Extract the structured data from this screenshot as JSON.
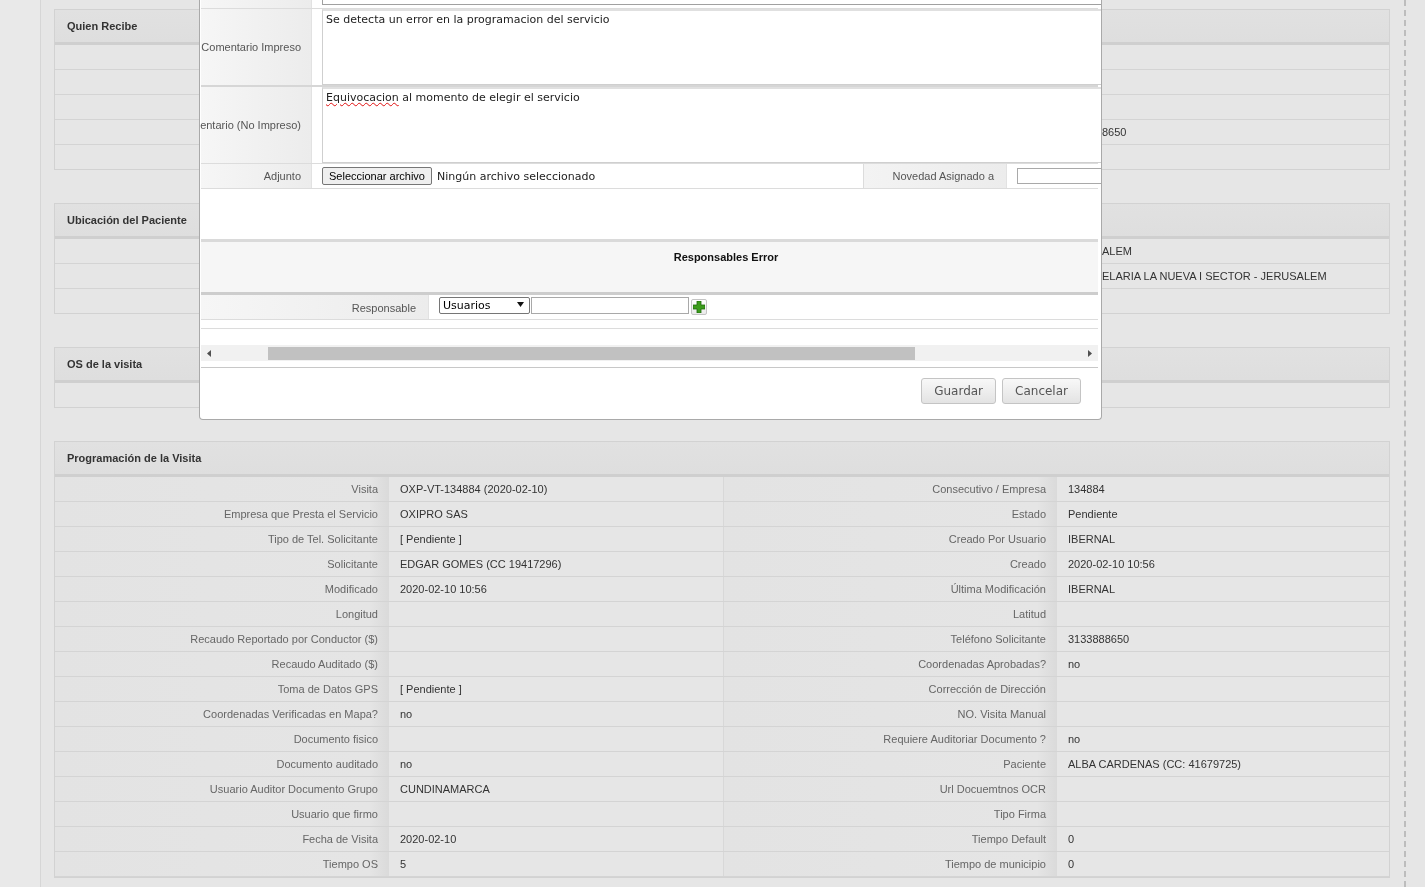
{
  "side_panels": [
    {
      "title": "Quien Recibe",
      "rows": [
        {},
        {},
        {},
        {
          "value": "8650"
        },
        {}
      ]
    },
    {
      "title": "Ubicación del Paciente",
      "rows": [
        {
          "value": "ALEM"
        },
        {
          "value": "ELARIA LA NUEVA I SECTOR - JERUSALEM"
        },
        {}
      ]
    },
    {
      "title": "OS de la visita",
      "rows": [
        {}
      ]
    }
  ],
  "visit_schedule": {
    "title": "Programación de la Visita",
    "rows": [
      {
        "left": {
          "label": "Visita",
          "value": "OXP-VT-134884 (2020-02-10)"
        },
        "right": {
          "label": "Consecutivo / Empresa",
          "value": "134884"
        }
      },
      {
        "left": {
          "label": "Empresa que Presta el Servicio",
          "value": "OXIPRO SAS"
        },
        "right": {
          "label": "Estado",
          "value": "Pendiente"
        }
      },
      {
        "left": {
          "label": "Tipo de Tel. Solicitante",
          "value": "[ Pendiente ]"
        },
        "right": {
          "label": "Creado Por Usuario",
          "value": "IBERNAL"
        }
      },
      {
        "left": {
          "label": "Solicitante",
          "value": "EDGAR GOMES (CC 19417296)"
        },
        "right": {
          "label": "Creado",
          "value": "2020-02-10 10:56"
        }
      },
      {
        "left": {
          "label": "Modificado",
          "value": "2020-02-10 10:56"
        },
        "right": {
          "label": "Última Modificación",
          "value": "IBERNAL"
        }
      },
      {
        "left": {
          "label": "Longitud"
        },
        "right": {
          "label": "Latitud"
        }
      },
      {
        "left": {
          "label": "Recaudo Reportado por Conductor ($)"
        },
        "right": {
          "label": "Teléfono Solicitante",
          "value": "3133888650"
        }
      },
      {
        "left": {
          "label": "Recaudo Auditado ($)"
        },
        "right": {
          "label": "Coordenadas Aprobadas?",
          "value": "no"
        }
      },
      {
        "left": {
          "label": "Toma de Datos GPS",
          "value": "[ Pendiente ]"
        },
        "right": {
          "label": "Corrección de Dirección"
        }
      },
      {
        "left": {
          "label": "Coordenadas Verificadas en Mapa?",
          "value": "no"
        },
        "right": {
          "label": "NO. Visita Manual"
        }
      },
      {
        "left": {
          "label": "Documento fisico"
        },
        "right": {
          "label": "Requiere Auditoriar Documento ?",
          "value": "no"
        }
      },
      {
        "left": {
          "label": "Documento auditado",
          "value": "no"
        },
        "right": {
          "label": "Paciente",
          "value": "ALBA CARDENAS (CC: 41679725)"
        }
      },
      {
        "left": {
          "label": "Usuario Auditor Documento Grupo",
          "value": "CUNDINAMARCA"
        },
        "right": {
          "label": "Url Docuemtnos OCR"
        }
      },
      {
        "left": {
          "label": "Usuario que firmo"
        },
        "right": {
          "label": "Tipo Firma"
        }
      },
      {
        "left": {
          "label": "Fecha de Visita",
          "value": "2020-02-10"
        },
        "right": {
          "label": "Tiempo Default",
          "value": "0"
        }
      },
      {
        "left": {
          "label": "Tiempo OS",
          "value": "5"
        },
        "right": {
          "label": "Tiempo de municipio",
          "value": "0"
        }
      }
    ]
  },
  "dialog": {
    "fields": [
      {
        "kind": "clipped"
      },
      {
        "kind": "textarea",
        "label": "Comentario Impreso",
        "value": "Se detecta un error en la programacion del servicio",
        "spellcheck_error": false
      },
      {
        "kind": "textarea",
        "label": "entario (No Impreso)",
        "value": "Equivocacion al momento de elegir el servicio",
        "spellcheck_error": true
      },
      {
        "kind": "file",
        "label": "Adjunto",
        "button": "Seleccionar archivo",
        "status": "Ningún archivo seleccionado",
        "side_label": "Novedad Asignado a"
      }
    ],
    "section_title": "Responsables Error",
    "responsable": {
      "label": "Responsable",
      "select": "Usuarios"
    },
    "buttons": [
      "Guardar",
      "Cancelar"
    ]
  }
}
